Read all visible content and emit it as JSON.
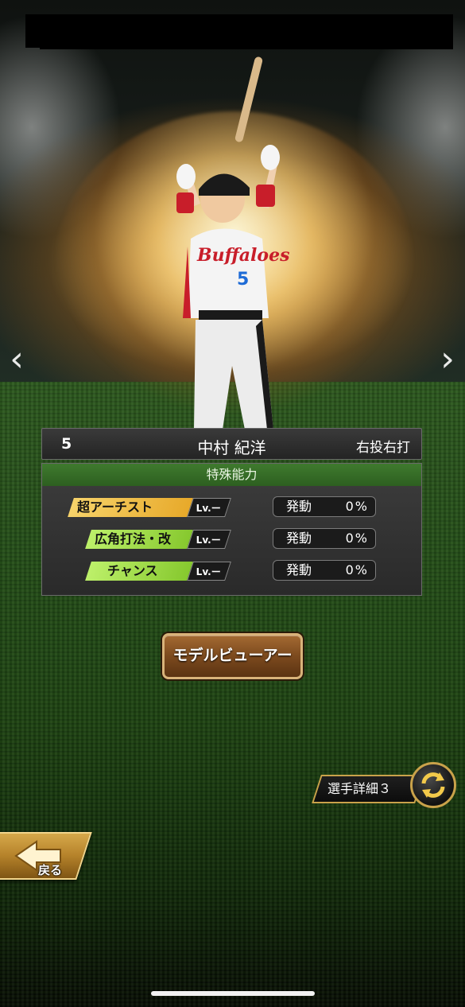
{
  "player": {
    "number": "5",
    "name": "中村 紀洋",
    "throw_bat": "右投右打",
    "uniform_text": "Buffaloes",
    "uniform_number": "5"
  },
  "abilities": {
    "header": "特殊能力",
    "items": [
      {
        "label": "超アーチスト",
        "prefix": "超",
        "lv": "Lv.ー",
        "activation_label": "発動",
        "activation_value": "0%",
        "color": "#f2c14a"
      },
      {
        "label": "広角打法・改",
        "lv": "Lv.ー",
        "activation_label": "発動",
        "activation_value": "0%",
        "color": "#a4e24a"
      },
      {
        "label": "チャンス",
        "lv": "Lv.ー",
        "activation_label": "発動",
        "activation_value": "0%",
        "color": "#a4e24a"
      }
    ]
  },
  "buttons": {
    "model_viewer": "モデルビューアー",
    "player_detail": "選手詳細３",
    "back": "戻る"
  },
  "nav": {
    "prev_icon": "‹",
    "next_icon": "›"
  },
  "colors": {
    "accent_gold": "#c9a24a",
    "panel_header_green": "#3f7a2e",
    "button_brown": "#7c4a1e"
  }
}
